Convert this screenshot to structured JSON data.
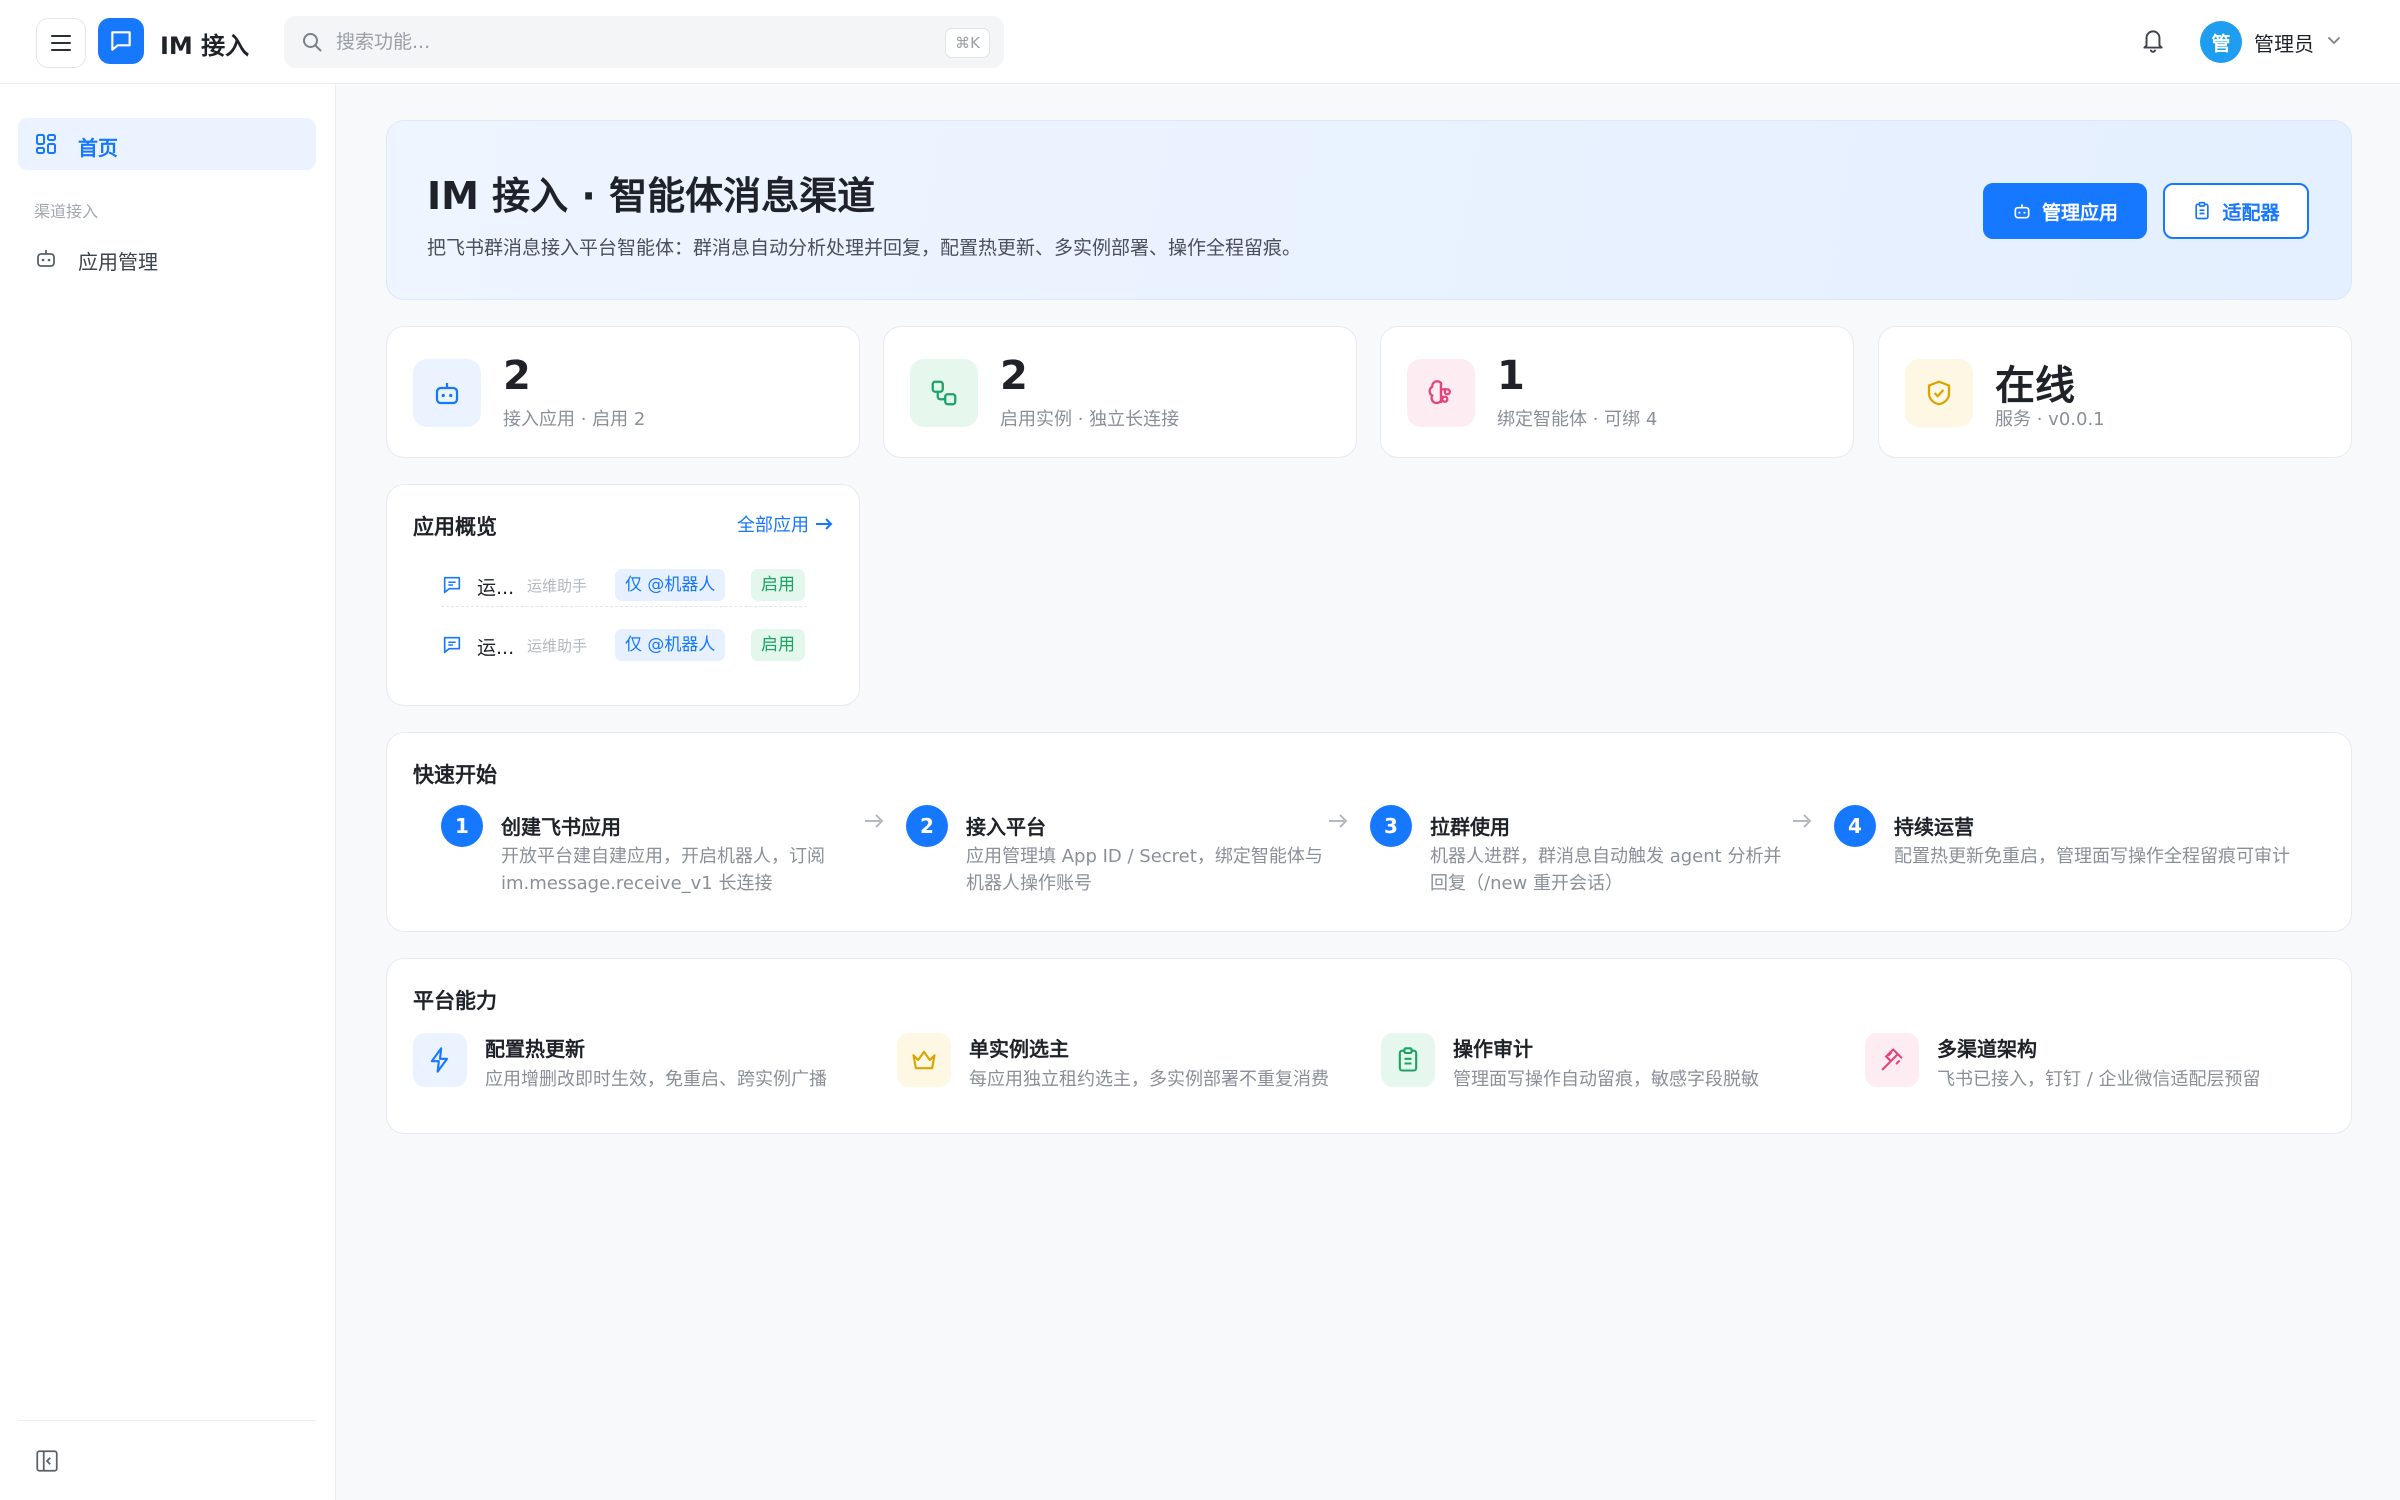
{
  "header": {
    "app_title": "IM 接入",
    "search_placeholder": "搜索功能...",
    "search_shortcut": "⌘K",
    "user_avatar": "管",
    "user_name": "管理员"
  },
  "sidebar": {
    "home_label": "首页",
    "section_label": "渠道接入",
    "apps_label": "应用管理"
  },
  "hero": {
    "title": "IM 接入 · 智能体消息渠道",
    "description": "把飞书群消息接入平台智能体：群消息自动分析处理并回复，配置热更新、多实例部署、操作全程留痕。",
    "primary_button": "管理应用",
    "secondary_button": "适配器"
  },
  "stats": [
    {
      "value": "2",
      "label": "接入应用 · 启用 2",
      "color": "#1677ff"
    },
    {
      "value": "2",
      "label": "启用实例 · 独立长连接",
      "color": "#1aa363"
    },
    {
      "value": "1",
      "label": "绑定智能体 · 可绑 4",
      "color": "#e0457b"
    },
    {
      "value": "在线",
      "label": "服务 · v0.0.1",
      "color": "#d9a400"
    }
  ],
  "overview": {
    "title": "应用概览",
    "link": "全部应用",
    "rows": [
      {
        "name": "运...",
        "role": "运维助手",
        "mode": "仅 @机器人",
        "status": "启用"
      },
      {
        "name": "运...",
        "role": "运维助手",
        "mode": "仅 @机器人",
        "status": "启用"
      }
    ]
  },
  "quick_start": {
    "title": "快速开始",
    "steps": [
      {
        "num": "1",
        "title": "创建飞书应用",
        "desc": "开放平台建自建应用，开启机器人，订阅 im.message.receive_v1 长连接"
      },
      {
        "num": "2",
        "title": "接入平台",
        "desc": "应用管理填 App ID / Secret，绑定智能体与机器人操作账号"
      },
      {
        "num": "3",
        "title": "拉群使用",
        "desc": "机器人进群，群消息自动触发 agent 分析并回复（/new 重开会话）"
      },
      {
        "num": "4",
        "title": "持续运营",
        "desc": "配置热更新免重启，管理面写操作全程留痕可审计"
      }
    ]
  },
  "abilities": {
    "title": "平台能力",
    "items": [
      {
        "title": "配置热更新",
        "desc": "应用增删改即时生效，免重启、跨实例广播",
        "icon": "bolt-icon"
      },
      {
        "title": "单实例选主",
        "desc": "每应用独立租约选主，多实例部署不重复消费",
        "icon": "crown-icon"
      },
      {
        "title": "操作审计",
        "desc": "管理面写操作自动留痕，敏感字段脱敏",
        "icon": "clipboard-icon"
      },
      {
        "title": "多渠道架构",
        "desc": "飞书已接入，钉钉 / 企业微信适配层预留",
        "icon": "plug-icon"
      }
    ]
  },
  "colors": {
    "brand": "#1677ff",
    "success": "#1aa363"
  }
}
